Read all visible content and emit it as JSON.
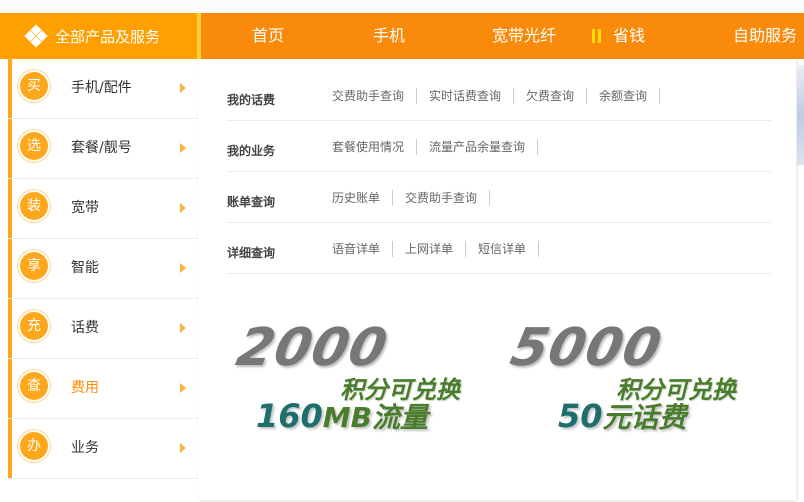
{
  "nav": {
    "all_label": "全部产品及服务",
    "items": [
      {
        "label": "首页"
      },
      {
        "label": "手机"
      },
      {
        "label": "宽带光纤"
      },
      {
        "label": "省钱"
      },
      {
        "label": "自助服务"
      }
    ]
  },
  "left_menu": [
    {
      "badge": "买",
      "label": "手机/配件"
    },
    {
      "badge": "选",
      "label": "套餐/靓号"
    },
    {
      "badge": "装",
      "label": "宽带"
    },
    {
      "badge": "享",
      "label": "智能"
    },
    {
      "badge": "充",
      "label": "话费"
    },
    {
      "badge": "查",
      "label": "费用"
    },
    {
      "badge": "办",
      "label": "业务"
    }
  ],
  "categories": [
    {
      "title": "我的话费",
      "links": [
        "交费助手查询",
        "实时话费查询",
        "欠费查询",
        "余额查询"
      ]
    },
    {
      "title": "我的业务",
      "links": [
        "套餐使用情况",
        "流量产品余量查询"
      ]
    },
    {
      "title": "账单查询",
      "links": [
        "历史账单",
        "交费助手查询"
      ]
    },
    {
      "title": "详细查询",
      "links": [
        "语音详单",
        "上网详单",
        "短信详单"
      ]
    }
  ],
  "promos": [
    {
      "big": "2000",
      "mid": "积分可兑换",
      "low": "160",
      "low_tail": "MB流量"
    },
    {
      "big": "5000",
      "mid": "积分可兑换",
      "low": "50",
      "low_tail": "元话费"
    }
  ],
  "colors": {
    "nav_bg": "#f98a0b",
    "nav_all_bg": "#ffa000",
    "accent": "#ffa71b",
    "active_text": "#ff8a00"
  }
}
